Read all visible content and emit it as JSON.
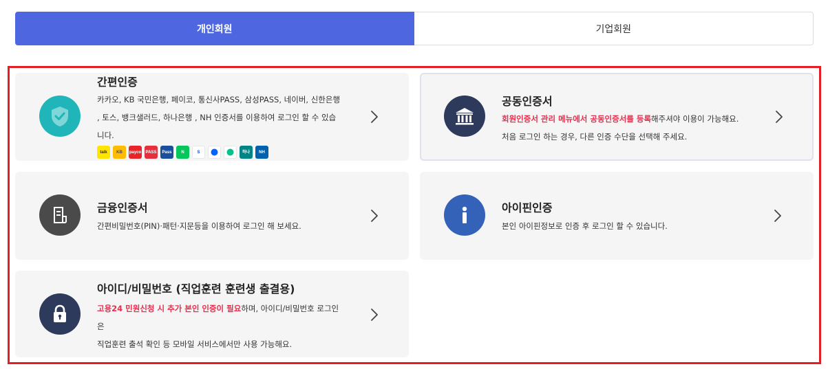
{
  "tabs": [
    {
      "label": "개인회원",
      "active": true
    },
    {
      "label": "기업회원",
      "active": false
    }
  ],
  "cards": {
    "simple": {
      "title": "간편인증",
      "desc_line1": "카카오, KB 국민은행, 페이코, 통신사PASS, 삼성PASS, 네이버, 신한은행",
      "desc_line2": ", 토스, 뱅크샐러드, 하나은행 , NH 인증서를 이용하여 로그인 할 수 있습",
      "desc_line3": "니다.",
      "brands": [
        {
          "name": "kakao-icon",
          "text": "talk",
          "bg": "#fee500",
          "fg": "#3c1e1e"
        },
        {
          "name": "kb-icon",
          "text": "KB",
          "bg": "#ffbc00",
          "fg": "#5a4a3a"
        },
        {
          "name": "payco-icon",
          "text": "payco",
          "bg": "#e8232a",
          "fg": "#ffffff"
        },
        {
          "name": "pass-icon",
          "text": "PASS",
          "bg": "#e52f3d",
          "fg": "#ffffff"
        },
        {
          "name": "samsung-pass-icon",
          "text": "Pass",
          "bg": "#1a4f9e",
          "fg": "#ffffff"
        },
        {
          "name": "naver-icon",
          "text": "N",
          "bg": "#03c75a",
          "fg": "#ffffff"
        },
        {
          "name": "shinhan-icon",
          "text": "S",
          "bg": "#ffffff",
          "fg": "#0046ff"
        },
        {
          "name": "toss-icon",
          "text": "",
          "bg": "#ffffff",
          "fg": "#0064ff"
        },
        {
          "name": "banksalad-icon",
          "text": "",
          "bg": "#ffffff",
          "fg": "#00c389"
        },
        {
          "name": "hana-icon",
          "text": "하나",
          "bg": "#008485",
          "fg": "#ffffff"
        },
        {
          "name": "nh-icon",
          "text": "NH",
          "bg": "#0062ae",
          "fg": "#ffffff"
        }
      ]
    },
    "joint": {
      "title": "공동인증서",
      "desc_red": "회원인증서 관리 메뉴에서 공동인증서를 등록",
      "desc_rest": "해주셔야 이용이 가능해요.",
      "desc_line2": "처음 로그인 하는 경우, 다른 인증 수단을 선택해 주세요."
    },
    "financial": {
      "title": "금융인증서",
      "desc": "간편비밀번호(PIN)·패턴·지문등을 이용하여 로그인 해 보세요."
    },
    "ipin": {
      "title": "아이핀인증",
      "desc": "본인 아이핀정보로 인증 후 로그인 할 수 있습니다."
    },
    "idpw": {
      "title": "아이디/비밀번호 (직업훈련 훈련생 출결용)",
      "desc_red": "고용24 민원신청 시 추가 본인 인증이 필요",
      "desc_rest": "하며, 아이디/비밀번호 로그인",
      "desc_line2": "은",
      "desc_line3": "직업훈련 출석 확인 등 모바일 서비스에서만 사용 가능해요."
    }
  },
  "colors": {
    "accent": "#4f66e1",
    "highlight": "#e31e24",
    "teal": "#1fb5b9",
    "navy": "#2e3a5c",
    "gray_dark": "#4a4a4a",
    "blue": "#3462b8",
    "red_text": "#e62e4d"
  }
}
